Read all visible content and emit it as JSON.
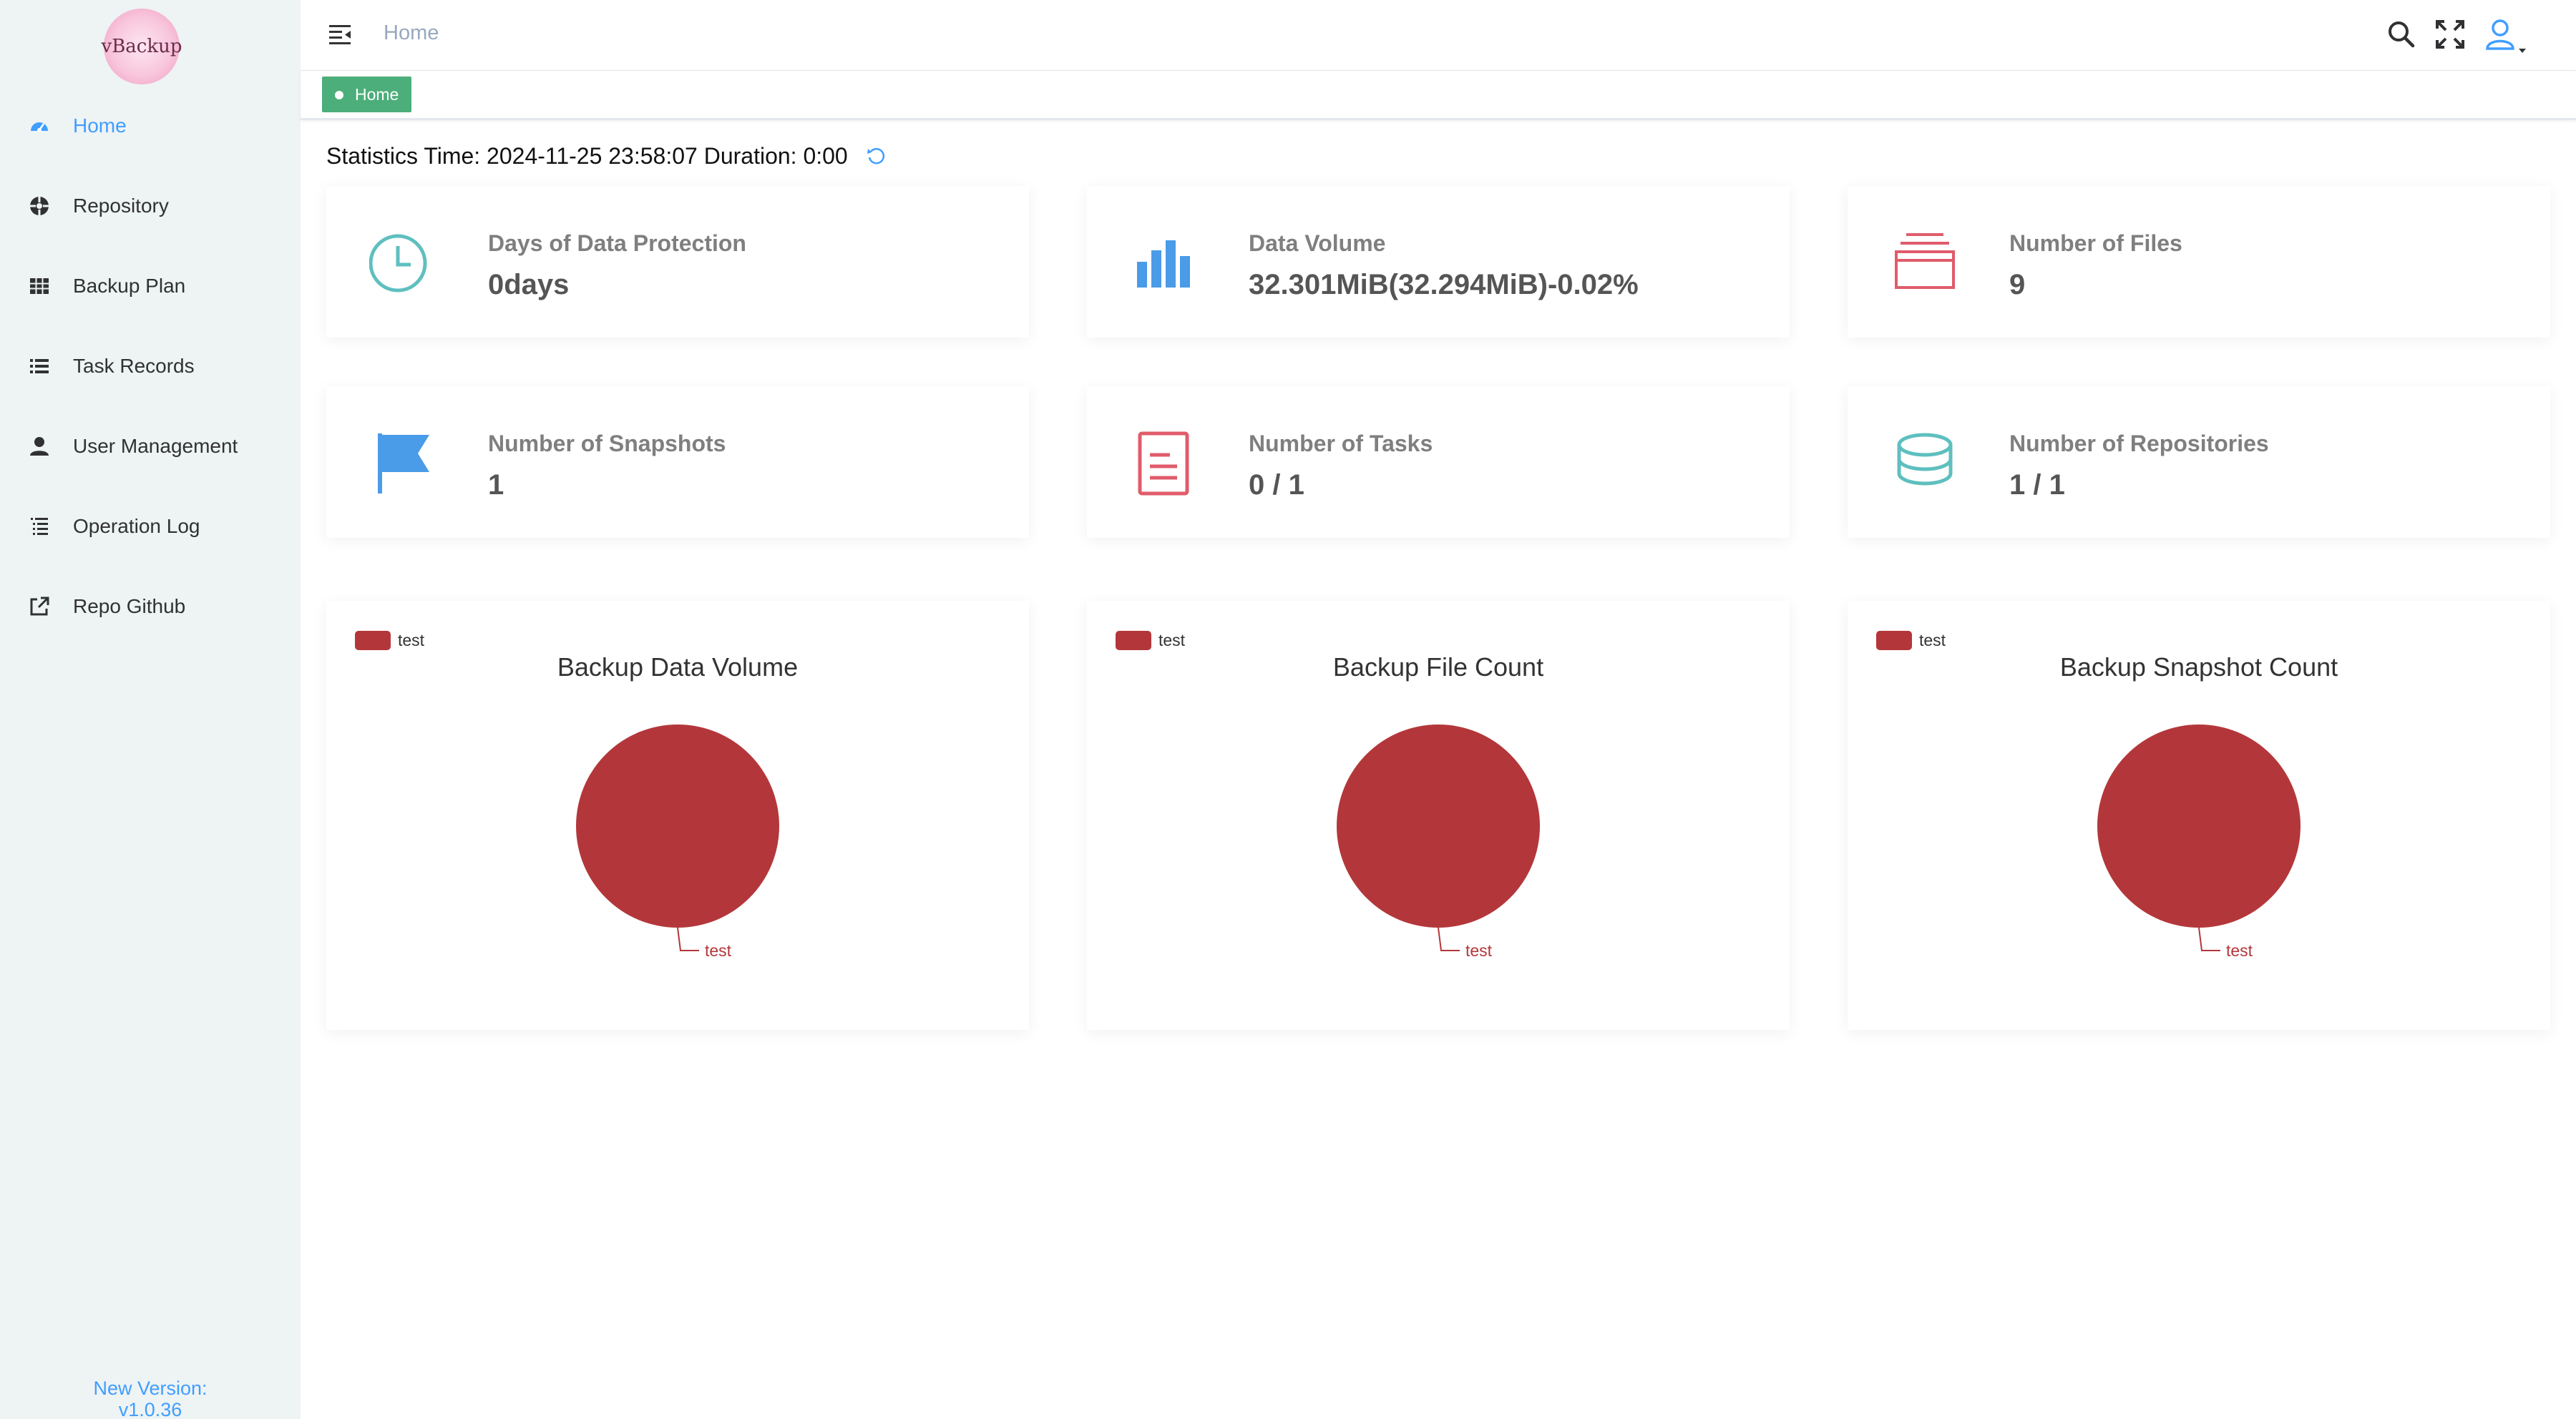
{
  "app": {
    "logo_text": "vBackup"
  },
  "sidebar": {
    "items": [
      {
        "label": "Home",
        "icon": "dashboard-icon",
        "active": true
      },
      {
        "label": "Repository",
        "icon": "target-icon",
        "active": false
      },
      {
        "label": "Backup Plan",
        "icon": "grid-icon",
        "active": false
      },
      {
        "label": "Task Records",
        "icon": "list-icon",
        "active": false
      },
      {
        "label": "User Management",
        "icon": "user-icon",
        "active": false
      },
      {
        "label": "Operation Log",
        "icon": "log-icon",
        "active": false
      },
      {
        "label": "Repo Github",
        "icon": "external-link-icon",
        "active": false
      }
    ],
    "version_label": "New Version:",
    "version_number": "v1.0.36"
  },
  "header": {
    "breadcrumb": "Home",
    "tag": "Home",
    "icons": [
      "search-icon",
      "fullscreen-icon",
      "user-avatar-icon"
    ]
  },
  "stats": {
    "label": "Statistics Time: 2024-11-25 23:58:07 Duration: 0:00"
  },
  "cards": [
    {
      "title": "Days of Data Protection",
      "value": "0days",
      "icon": "clock-icon",
      "color": "#5fbfbf"
    },
    {
      "title": "Data Volume",
      "value": "32.301MiB(32.294MiB)-0.02%",
      "icon": "bar-chart-icon",
      "color": "#4a9be8"
    },
    {
      "title": "Number of Files",
      "value": "9",
      "icon": "layers-icon",
      "color": "#e05c6b"
    },
    {
      "title": "Number of Snapshots",
      "value": "1",
      "icon": "flag-icon",
      "color": "#4a9be8"
    },
    {
      "title": "Number of Tasks",
      "value": "0 / 1",
      "icon": "document-icon",
      "color": "#e05c6b"
    },
    {
      "title": "Number of Repositories",
      "value": "1 / 1",
      "icon": "database-icon",
      "color": "#5fbfbf"
    }
  ],
  "colors": {
    "accent": "#409eff",
    "pie": "#b3373a",
    "tag": "#4cae7a"
  },
  "chart_data": [
    {
      "type": "pie",
      "title": "Backup Data Volume",
      "legend": [
        "test"
      ],
      "legend_placement": "top-left",
      "slices": [
        {
          "name": "test",
          "value": 1
        }
      ]
    },
    {
      "type": "pie",
      "title": "Backup File Count",
      "legend": [
        "test"
      ],
      "legend_placement": "top-left",
      "slices": [
        {
          "name": "test",
          "value": 1
        }
      ]
    },
    {
      "type": "pie",
      "title": "Backup Snapshot Count",
      "legend": [
        "test"
      ],
      "legend_placement": "top-left",
      "slices": [
        {
          "name": "test",
          "value": 1
        }
      ]
    }
  ]
}
